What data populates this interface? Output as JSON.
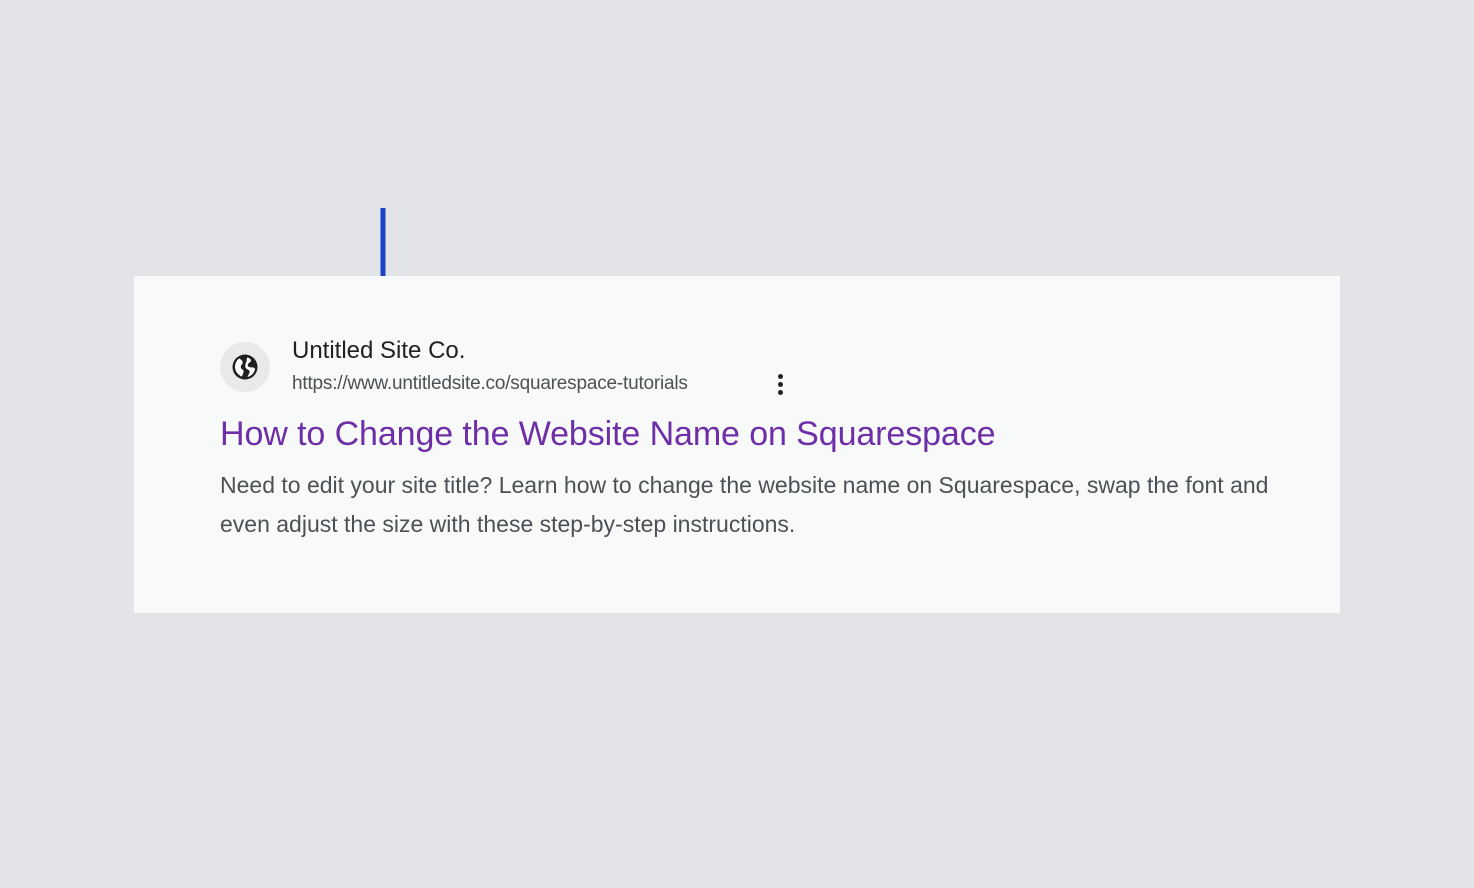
{
  "result": {
    "site_name": "Untitled Site Co.",
    "url": "https://www.untitledsite.co/squarespace-tutorials",
    "title": "How to Change the Website Name on Squarespace",
    "snippet": "Need to edit your site title? Learn how to change the website name on Squarespace, swap the font and even adjust the size with these step-by-step instructions.",
    "favicon_icon": "globe-icon",
    "menu_icon": "more-vertical-icon"
  },
  "annotation": {
    "arrow_icon": "arrow-down-icon"
  },
  "colors": {
    "background": "#e2e4e7",
    "card": "#f8f9f9",
    "title_link": "#6e2ea8",
    "arrow": "#1a43c8",
    "text_primary": "#202124",
    "text_secondary": "#4d5156"
  }
}
